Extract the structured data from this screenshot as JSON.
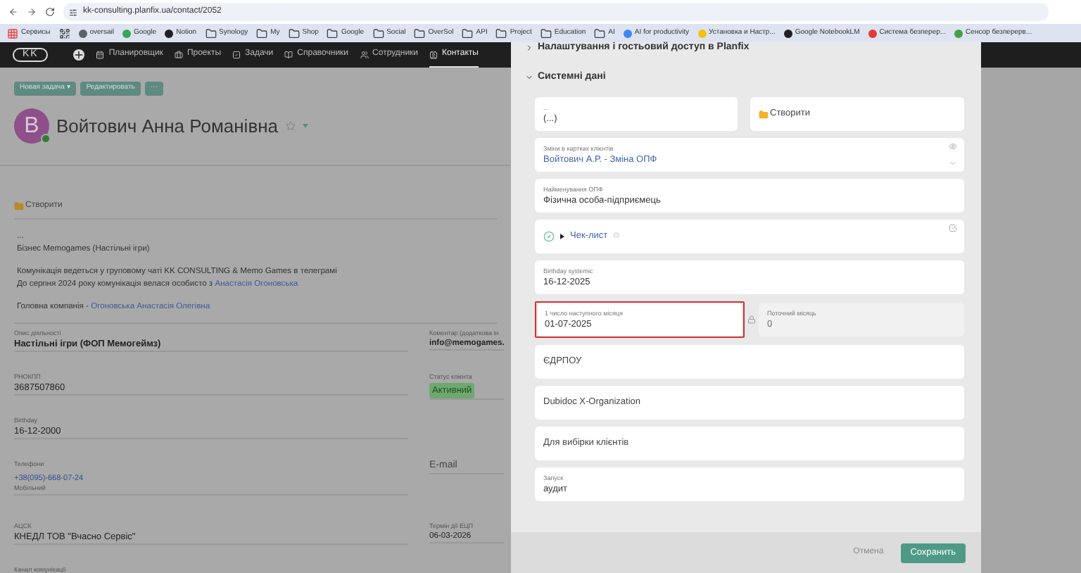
{
  "browser": {
    "url": "kk-consulting.planfix.ua/contact/2052",
    "bookmarks": [
      {
        "label": "Сервисы",
        "kind": "apps"
      },
      {
        "kind": "grid"
      },
      {
        "label": "oversail",
        "kind": "site",
        "color": "#5f6368"
      },
      {
        "label": "Google",
        "kind": "site",
        "color": "#34a853"
      },
      {
        "label": "Notion",
        "kind": "site",
        "color": "#202020"
      },
      {
        "label": "Synology",
        "kind": "folder"
      },
      {
        "label": "My",
        "kind": "folder"
      },
      {
        "label": "Shop",
        "kind": "folder"
      },
      {
        "label": "Google",
        "kind": "folder"
      },
      {
        "label": "Social",
        "kind": "folder"
      },
      {
        "label": "OverSol",
        "kind": "folder"
      },
      {
        "label": "API",
        "kind": "folder"
      },
      {
        "label": "Project",
        "kind": "folder"
      },
      {
        "label": "Education",
        "kind": "folder"
      },
      {
        "label": "AI",
        "kind": "folder"
      },
      {
        "label": "AI for productivity",
        "kind": "site",
        "color": "#4285f4"
      },
      {
        "label": "Установка и Настр...",
        "kind": "site",
        "color": "#f4c20d"
      },
      {
        "label": "Google NotebookLM",
        "kind": "site",
        "color": "#202020"
      },
      {
        "label": "Система безперер...",
        "kind": "site",
        "color": "#e53935"
      },
      {
        "label": "Сенсор безперерв...",
        "kind": "site",
        "color": "#43a047"
      }
    ]
  },
  "nav": {
    "logo": "KK",
    "items": [
      {
        "label": "Планировщик",
        "selected": false
      },
      {
        "label": "Проекты",
        "selected": false
      },
      {
        "label": "Задачи",
        "selected": false
      },
      {
        "label": "Справочники",
        "selected": false
      },
      {
        "label": "Сотрудники",
        "selected": false
      },
      {
        "label": "Контакты",
        "selected": true
      }
    ]
  },
  "toolbar": [
    {
      "label": "Новая задача ▾"
    },
    {
      "label": "Редактировать"
    },
    {
      "label": "···"
    }
  ],
  "contact": {
    "avatar_letter": "В",
    "online": true,
    "name": "Войтович Анна Романівна",
    "starred": false
  },
  "create_link": "Створити",
  "description": [
    [
      [
        {
          "text": "..."
        }
      ],
      [
        {
          "text": "Бізнес Memogames (Настільні ігри)"
        }
      ]
    ],
    [
      [
        {
          "text": "Комунікація ведеться у груповому чаті KK CONSULTING & Memo Games в телеграмі"
        }
      ],
      [
        {
          "text": "До серпня 2024 року комунікація велася особисто з "
        },
        {
          "text": "Анастасія Огоновська",
          "link": true
        }
      ]
    ],
    [
      [
        {
          "text": "Головна компанія - "
        },
        {
          "text": "Огоновська Анастасія Олегівна",
          "link": true
        }
      ]
    ]
  ],
  "fields": [
    {
      "left": {
        "label": "Опис діяльності",
        "value": "Настільні ігри (ФОП Мемогеймз)",
        "kind": "bold"
      },
      "right": {
        "label": "Коментар (додаткова ін",
        "value": "info@memogames.",
        "kind": "bold"
      }
    },
    {
      "left": {
        "label": "РНОКПП",
        "value": "3687507860",
        "kind": "text"
      },
      "right": {
        "label": "Статус клієнта",
        "value": "Активний",
        "kind": "badge"
      }
    },
    {
      "left": {
        "label": "Birthday",
        "value": "16-12-2000",
        "kind": "text"
      }
    },
    {
      "left": {
        "label": "Телефони",
        "value": "+38(095)-668-07-24",
        "note": "Мобільний",
        "kind": "phone"
      },
      "right": {
        "label": "E-mail",
        "kind": "plain"
      }
    },
    {
      "left": {
        "label": "АЦСК",
        "value": "КНЕДЛ ТОВ \"Вчасно Сервіс\"",
        "kind": "text"
      },
      "right": {
        "label": "Термін дії ЕЦП",
        "value": "06-03-2026",
        "kind": "text"
      }
    },
    {
      "left": {
        "label": "Канал комунікації",
        "kind": "text"
      }
    }
  ],
  "modal": {
    "sections": [
      {
        "title": "Налаштування і гостьовий доступ в Planfix",
        "expanded": false
      },
      {
        "title": "Системні дані",
        "expanded": true
      }
    ],
    "cards": [
      {
        "kind": "split",
        "left": {
          "label": "...",
          "value": "(...)"
        },
        "right": {
          "value": "Створити"
        }
      },
      {
        "kind": "select",
        "label": "Зміни в картках клієнтів",
        "value": "Войтович А.Р. - Зміна ОПФ"
      },
      {
        "kind": "field",
        "label": "Найменування ОПФ",
        "value": "Фізична особа-підприємець"
      },
      {
        "kind": "checklist",
        "value": "Чек-лист"
      },
      {
        "kind": "field",
        "label": "Birthday systemic",
        "value": "16-12-2025"
      },
      {
        "kind": "pair",
        "left": {
          "label": "1 число наступного місяця",
          "value": "01-07-2025",
          "highlighted": true
        },
        "right": {
          "label": "Поточний місяць",
          "value": "0",
          "readonly": true
        }
      },
      {
        "kind": "empty",
        "label": "ЄДРПОУ"
      },
      {
        "kind": "empty",
        "label": "Dubidoc X-Organization"
      },
      {
        "kind": "empty",
        "label": "Для вибірки клієнтів"
      },
      {
        "kind": "field",
        "label": "Запуск",
        "value": "аудит"
      }
    ],
    "cancel": "Отмена",
    "save": "Сохранить"
  }
}
